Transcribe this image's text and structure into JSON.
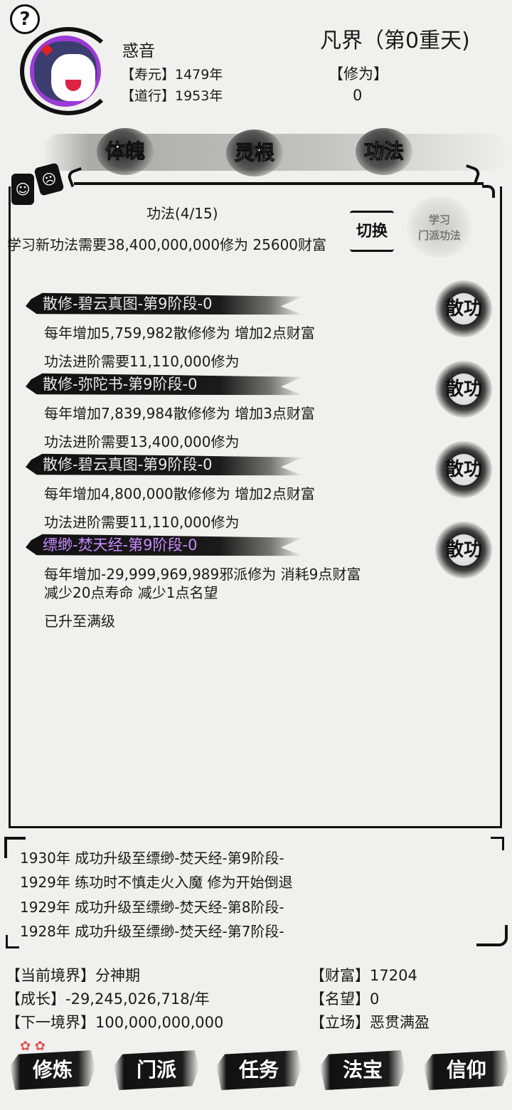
{
  "header": {
    "help_glyph": "?",
    "name": "惑音",
    "lifespan": "【寿元】1479年",
    "dao": "【道行】1953年",
    "realm": "凡界（第0重天)",
    "cultivation_label": "【修为】",
    "cultivation_value": "0"
  },
  "tabs": [
    {
      "label": "体魄"
    },
    {
      "label": "灵根"
    },
    {
      "label": "功法"
    }
  ],
  "masks": {
    "happy": "☺",
    "sad": "☹"
  },
  "panel": {
    "skill_count": "功法(4/15)",
    "learn_requirement": "学习新功法需要38,400,000,000修为 25600财富",
    "switch_label": "切换",
    "sect_skill_line1": "学习",
    "sect_skill_line2": "门派功法"
  },
  "skills": [
    {
      "title": "散修-碧云真图-第9阶段-0",
      "line1": "每年增加5,759,982散修修为 增加2点财富",
      "line2": "功法进阶需要11,110,000修为",
      "action": "散功"
    },
    {
      "title": "散修-弥陀书-第9阶段-0",
      "line1": "每年增加7,839,984散修修为 增加3点财富",
      "line2": "功法进阶需要13,400,000修为",
      "action": "散功"
    },
    {
      "title": "散修-碧云真图-第9阶段-0",
      "line1": "每年增加4,800,000散修修为 增加2点财富",
      "line2": "功法进阶需要11,110,000修为",
      "action": "散功"
    },
    {
      "title": "缥缈-焚天经-第9阶段-0",
      "line1": "每年增加-29,999,969,989邪派修为 消耗9点财富",
      "line1b": "减少20点寿命 减少1点名望",
      "line2": "已升至满级",
      "action": "散功",
      "title_color": "#c98bff"
    }
  ],
  "log": [
    "1930年 成功升级至缥缈-焚天经-第9阶段-",
    "1929年 练功时不慎走火入魔 修为开始倒退",
    "1929年 成功升级至缥缈-焚天经-第8阶段-",
    "1928年 成功升级至缥缈-焚天经-第7阶段-"
  ],
  "stats": {
    "realm": "【当前境界】分神期",
    "growth": "【成长】-29,245,026,718/年",
    "next_realm": "【下一境界】100,000,000,000",
    "wealth": "【财富】17204",
    "reputation": "【名望】0",
    "stance": "【立场】恶贯满盈"
  },
  "nav": [
    {
      "label": "修炼"
    },
    {
      "label": "门派"
    },
    {
      "label": "任务"
    },
    {
      "label": "法宝"
    },
    {
      "label": "信仰"
    }
  ],
  "decor": {
    "flower": "✿ ✿"
  }
}
